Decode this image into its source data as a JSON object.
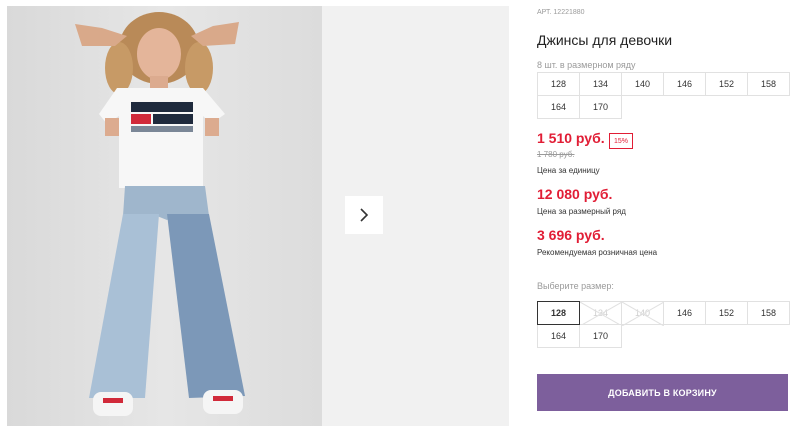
{
  "product": {
    "article": "АРТ. 12221880",
    "title": "Джинсы для девочки",
    "qty_note": "8 шт. в размерном ряду",
    "size_row": [
      "128",
      "134",
      "140",
      "146",
      "152",
      "158",
      "164",
      "170"
    ],
    "price_unit": "1 510 руб.",
    "discount": "15%",
    "old_price": "1 780 руб.",
    "price_unit_label": "Цена за единицу",
    "price_row": "12 080 руб.",
    "price_row_label": "Цена за размерный ряд",
    "price_retail": "3 696 руб.",
    "price_retail_label": "Рекомендуемая розничная цена",
    "choose_label": "Выберите размер:",
    "size_select": [
      {
        "label": "128",
        "state": "selected"
      },
      {
        "label": "134",
        "state": "disabled"
      },
      {
        "label": "140",
        "state": "disabled"
      },
      {
        "label": "146",
        "state": "available"
      },
      {
        "label": "152",
        "state": "available"
      },
      {
        "label": "158",
        "state": "available"
      },
      {
        "label": "164",
        "state": "available"
      },
      {
        "label": "170",
        "state": "available"
      }
    ],
    "cart_button": "ДОБАВИТЬ В КОРЗИНУ"
  },
  "colors": {
    "accent": "#7d5f9c",
    "price": "#e11d35"
  },
  "icons": {
    "next": "chevron-right-icon"
  }
}
